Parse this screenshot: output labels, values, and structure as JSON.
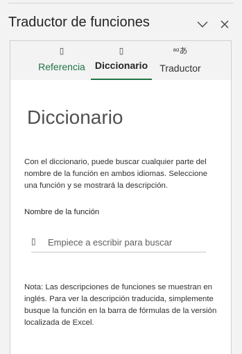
{
  "header": {
    "title": "Traductor de funciones",
    "collapse_icon": "chevron-down-icon",
    "close_icon": "close-icon"
  },
  "tabs": [
    {
      "label": "Referencia",
      "icon": "book-icon",
      "glyph": "▯",
      "active": false
    },
    {
      "label": "Diccionario",
      "icon": "dictionary-icon",
      "glyph": "▯",
      "active": true
    },
    {
      "label": "Traductor",
      "icon": "translate-icon",
      "glyph": "ᵃᵅあ",
      "active": false
    }
  ],
  "dictionary": {
    "heading": "Diccionario",
    "description": "Con el diccionario, puede buscar cualquier parte del nombre de la función en ambos idiomas. Seleccione una función y se mostrará la descripción.",
    "field_label": "Nombre de la función",
    "search": {
      "icon": "search-icon",
      "glyph": "▯",
      "value": "",
      "placeholder": "Empiece a escribir para buscar"
    },
    "note": "Nota: Las descripciones de funciones se muestran en inglés. Para ver la descripción traducida, simplemente busque la función en la barra de fórmulas de la versión localizada de Excel."
  },
  "colors": {
    "accent": "#217346",
    "pane_background": "#f3f3f3",
    "card_background": "#ffffff",
    "text": "#323130"
  }
}
